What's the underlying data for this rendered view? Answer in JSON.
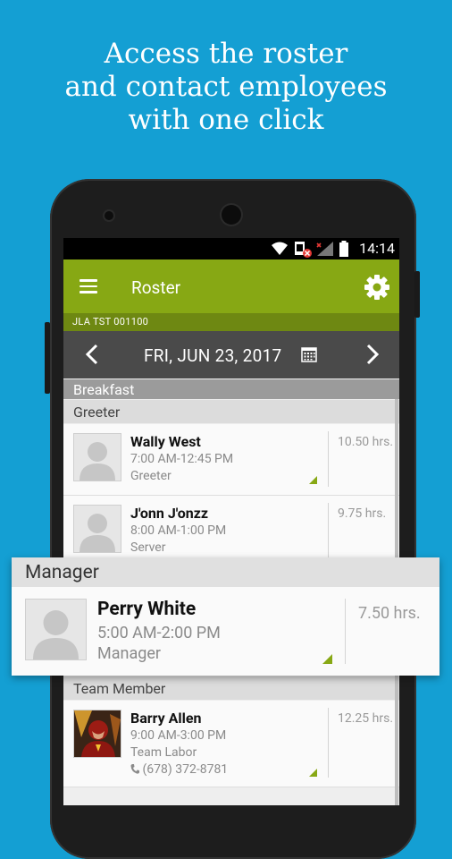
{
  "headline": [
    "Access the roster",
    "and contact employees",
    "with one click"
  ],
  "status_bar": {
    "time": "14:14"
  },
  "app_bar": {
    "title": "Roster"
  },
  "store": {
    "code": "JLA TST 001100"
  },
  "date_nav": {
    "date": "FRI, JUN 23, 2017"
  },
  "sections": {
    "breakfast": "Breakfast",
    "greeter": "Greeter",
    "team_member": "Team Member"
  },
  "employees": [
    {
      "name": "Wally West",
      "time": "7:00 AM-12:45 PM",
      "role": "Greeter",
      "hours": "10.50 hrs."
    },
    {
      "name": "J'onn J'onzz",
      "time": "8:00 AM-1:00 PM",
      "role": "Server",
      "hours": "9.75 hrs."
    },
    {
      "name": "Barry Allen",
      "time": "9:00 AM-3:00 PM",
      "role": "Team Labor",
      "phone": "(678) 372-8781",
      "hours": "12.25 hrs."
    }
  ],
  "featured": {
    "section": "Manager",
    "name": "Perry White",
    "time": "5:00 AM-2:00 PM",
    "role": "Manager",
    "hours": "7.50 hrs."
  },
  "colors": {
    "background": "#149fd3",
    "app_bar": "#87a814",
    "store_bar": "#6e8812",
    "date_bar": "#4a4a4a"
  }
}
